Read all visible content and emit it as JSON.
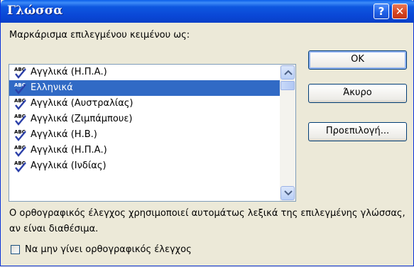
{
  "window": {
    "title": "Γλώσσα",
    "help_label": "?",
    "close_label": "✕"
  },
  "main": {
    "list_label": "Μαρκάρισμα επιλεγμένου κειμένου ως:",
    "languages": [
      {
        "label": "Αγγλικά (Η.Π.Α.)",
        "selected": false
      },
      {
        "label": "Ελληνικά",
        "selected": true
      },
      {
        "label": "Αγγλικά (Αυστραλίας)",
        "selected": false
      },
      {
        "label": "Αγγλικά (Ζιμπάμπουε)",
        "selected": false
      },
      {
        "label": "Αγγλικά (Η.Β.)",
        "selected": false
      },
      {
        "label": "Αγγλικά (Η.Π.Α.)",
        "selected": false
      },
      {
        "label": "Αγγλικά (Ινδίας)",
        "selected": false
      }
    ],
    "info_text": "Ο ορθογραφικός έλεγχος χρησιμοποιεί αυτομάτως λεξικά της επιλεγμένης γλώσσας, αν είναι διαθέσιμα.",
    "checkbox_label": "Να μην γίνει ορθογραφικός έλεγχος",
    "checkbox_checked": false
  },
  "buttons": {
    "ok": "OK",
    "cancel": "Άκυρο",
    "default": "Προεπιλογή..."
  },
  "icons": {
    "spellcheck": "abc-check-icon"
  },
  "colors": {
    "selection": "#316AC5",
    "titlebar": "#0A47D6"
  }
}
